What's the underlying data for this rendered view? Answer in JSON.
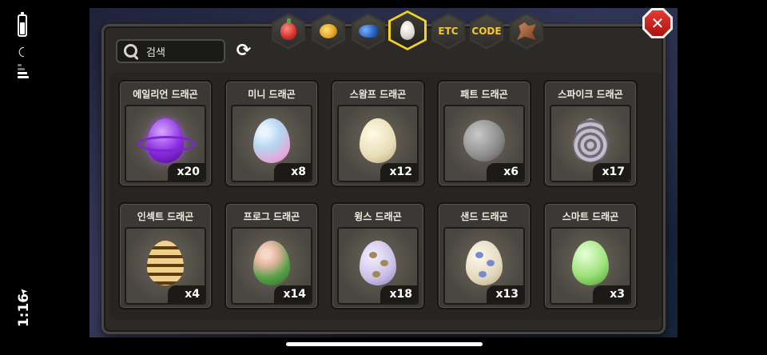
{
  "status_bar": {
    "time": "1:16"
  },
  "search": {
    "placeholder": "검색"
  },
  "tabs": [
    {
      "id": "fruit",
      "icon": "fruit-icon"
    },
    {
      "id": "coin",
      "icon": "coin-icon"
    },
    {
      "id": "fish",
      "icon": "fish-icon"
    },
    {
      "id": "egg",
      "icon": "egg-icon",
      "active": true
    },
    {
      "id": "etc",
      "label": "ETC"
    },
    {
      "id": "code",
      "label": "CODE"
    },
    {
      "id": "dragon",
      "icon": "dragon-icon"
    }
  ],
  "items": [
    {
      "name": "에일리언 드래곤",
      "count": "x20",
      "egg": "alien"
    },
    {
      "name": "미니 드래곤",
      "count": "x8",
      "egg": "mini"
    },
    {
      "name": "스왐프 드래곤",
      "count": "x12",
      "egg": "swamp"
    },
    {
      "name": "패트 드래곤",
      "count": "x6",
      "egg": "fat"
    },
    {
      "name": "스파이크 드래곤",
      "count": "x17",
      "egg": "spike"
    },
    {
      "name": "인섹트 드래곤",
      "count": "x4",
      "egg": "insect"
    },
    {
      "name": "프로그 드래곤",
      "count": "x14",
      "egg": "frog"
    },
    {
      "name": "윙스 드래곤",
      "count": "x18",
      "egg": "wings"
    },
    {
      "name": "샌드 드래곤",
      "count": "x13",
      "egg": "sand"
    },
    {
      "name": "스마트 드래곤",
      "count": "x3",
      "egg": "smart"
    }
  ]
}
